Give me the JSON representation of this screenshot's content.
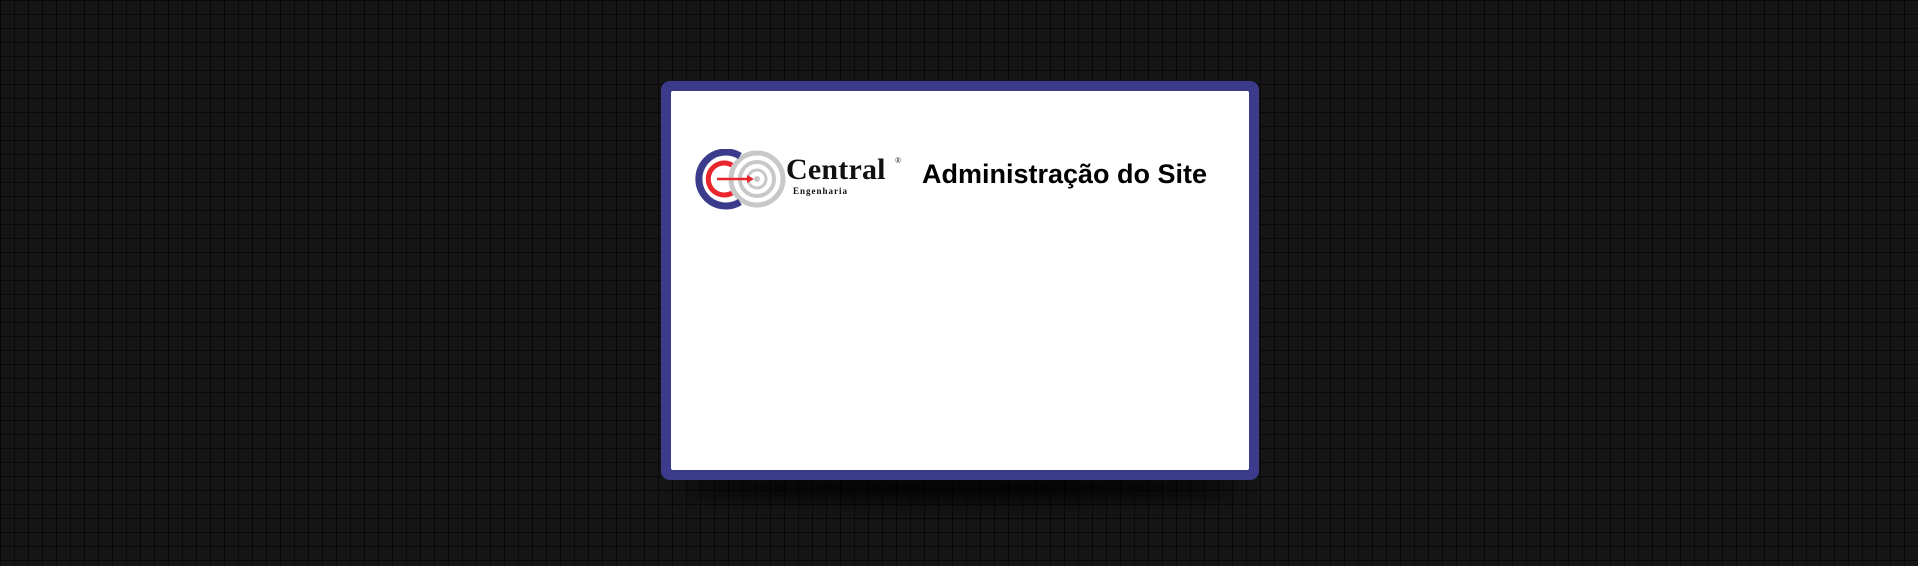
{
  "brand": {
    "name": "Central",
    "registered_mark": "®",
    "subtitle": "Engenharia",
    "logo_icon": "central-engenharia-logo-icon",
    "colors": {
      "ring_blue": "#3b3b8c",
      "ring_red": "#e8262b",
      "ring_gray": "#c8c8c8"
    }
  },
  "page": {
    "title": "Administração do Site",
    "frame_color": "#3b3b8c",
    "background_color": "#151515"
  }
}
